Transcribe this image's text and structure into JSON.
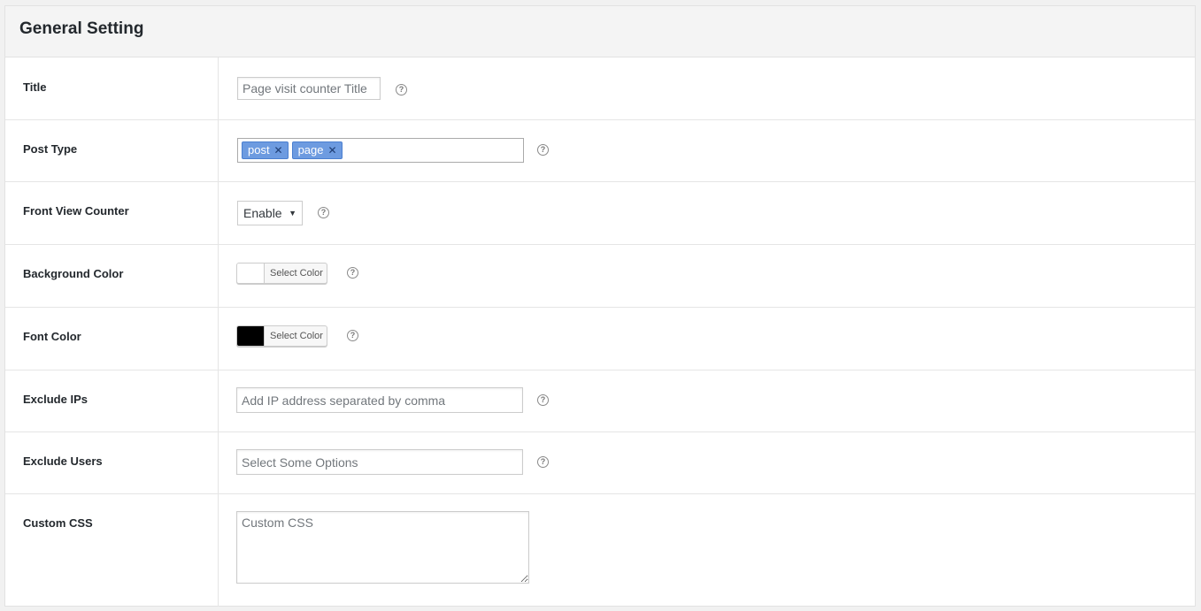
{
  "panel": {
    "title": "General Setting"
  },
  "rows": {
    "title": {
      "label": "Title",
      "placeholder": "Page visit counter Title"
    },
    "post_type": {
      "label": "Post Type",
      "tags": [
        "post",
        "page"
      ],
      "remove_glyph": "✕"
    },
    "front_view_counter": {
      "label": "Front View Counter",
      "selected": "Enable"
    },
    "background_color": {
      "label": "Background Color",
      "button_label": "Select Color",
      "swatch": "#ffffff"
    },
    "font_color": {
      "label": "Font Color",
      "button_label": "Select Color",
      "swatch": "#000000"
    },
    "exclude_ips": {
      "label": "Exclude IPs",
      "placeholder": "Add IP address separated by comma"
    },
    "exclude_users": {
      "label": "Exclude Users",
      "placeholder": "Select Some Options"
    },
    "custom_css": {
      "label": "Custom CSS",
      "placeholder": "Custom CSS"
    }
  },
  "icons": {
    "help": "question-circle-icon",
    "dropdown": "chevron-down-icon"
  },
  "colors": {
    "tag_bg": "#6d9be0",
    "panel_header_bg": "#f4f4f4",
    "border": "#e5e5e5"
  }
}
